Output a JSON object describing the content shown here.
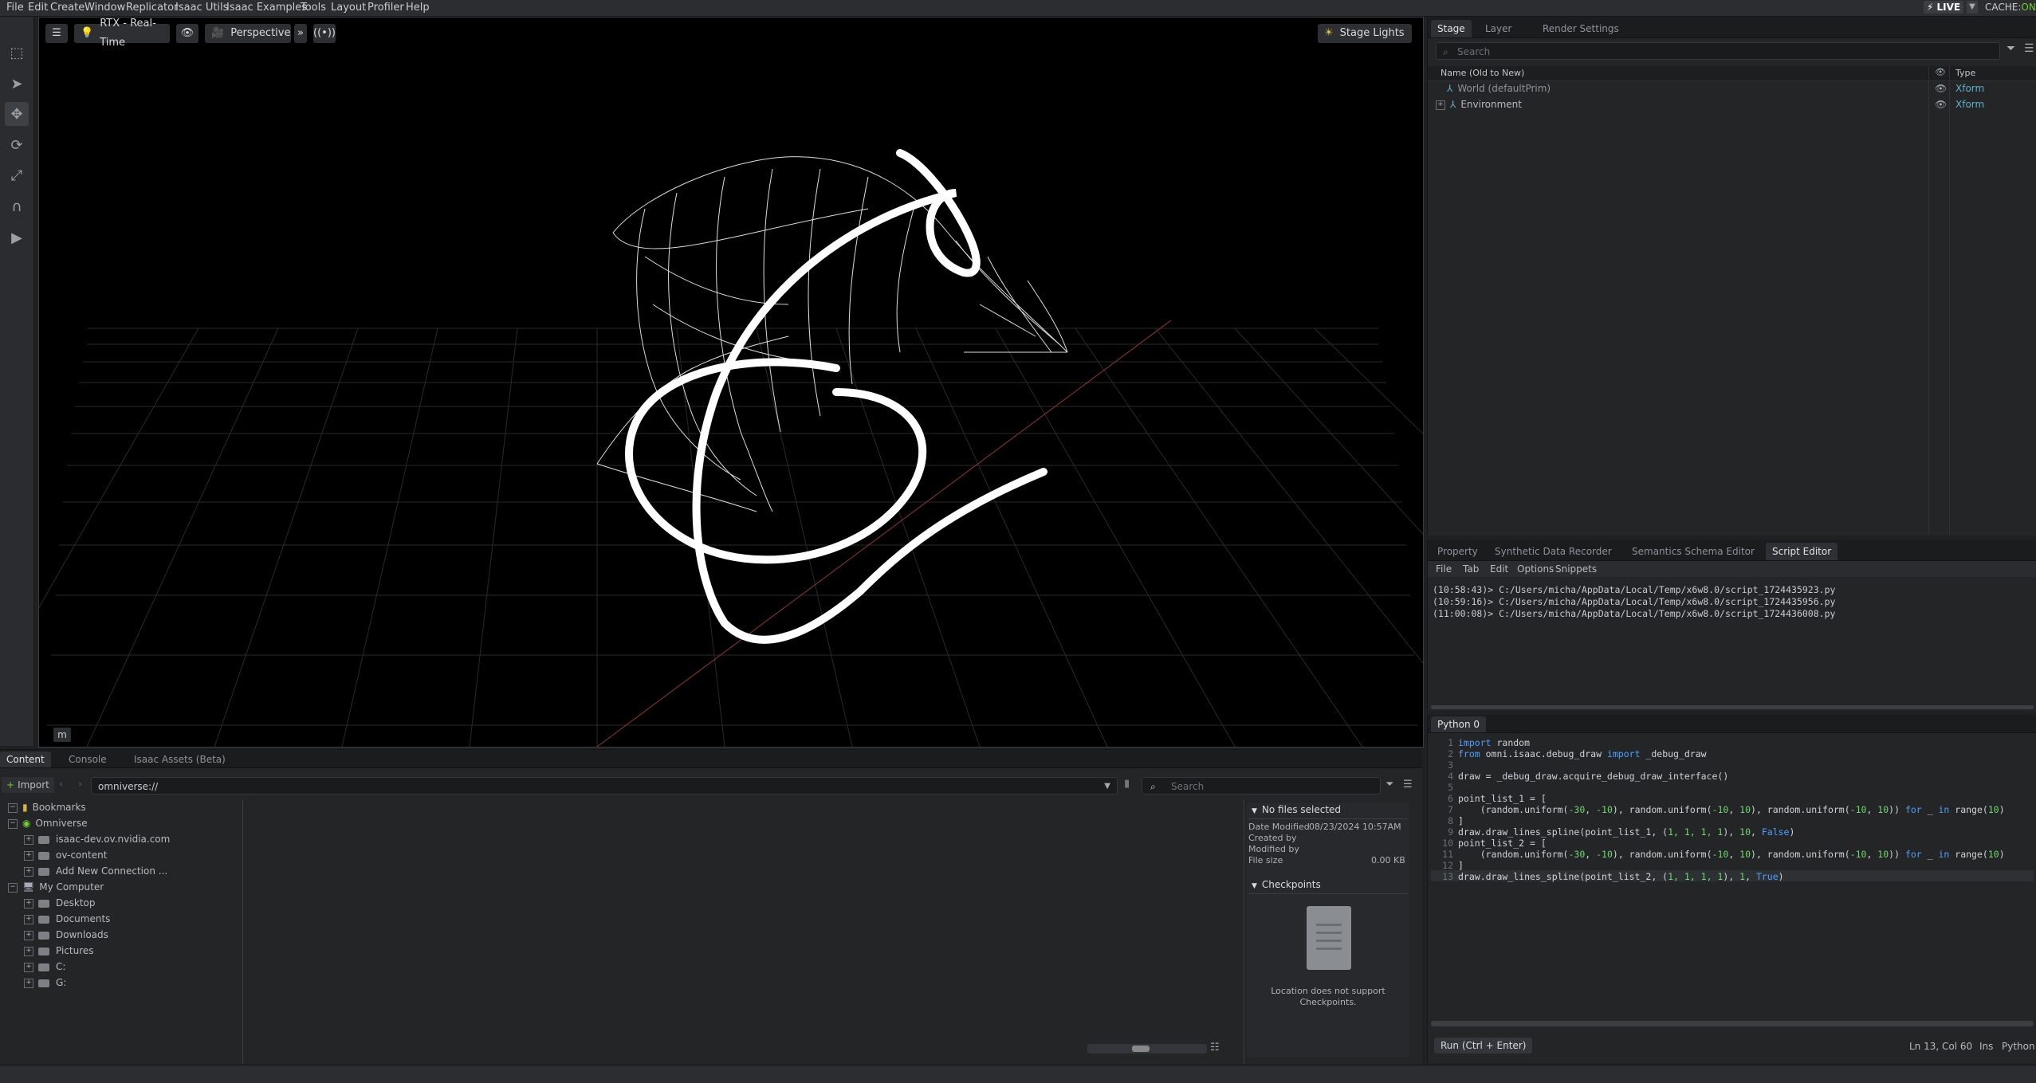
{
  "menu": [
    "File",
    "Edit",
    "Create",
    "Window",
    "Replicator",
    "Isaac Utils",
    "Isaac Examples",
    "Tools",
    "Layout",
    "Profiler",
    "Help"
  ],
  "status_top": {
    "live": "LIVE",
    "cache_label": "CACHE:",
    "cache_state": "ON"
  },
  "viewport": {
    "render_mode": "RTX - Real-Time",
    "camera": "Perspective",
    "stage_lights": "Stage Lights",
    "corner_label": "m"
  },
  "stage_panel": {
    "tabs": [
      "Stage",
      "Layer",
      "Render Settings"
    ],
    "search_placeholder": "Search",
    "col_name": "Name (Old to New)",
    "col_type": "Type",
    "rows": [
      {
        "name": "World (defaultPrim)",
        "type": "Xform"
      },
      {
        "name": "Environment",
        "type": "Xform"
      }
    ]
  },
  "property_panel": {
    "tabs": [
      "Property",
      "Synthetic Data Recorder",
      "Semantics Schema Editor",
      "Script Editor"
    ],
    "menu": [
      "File",
      "Tab",
      "Edit",
      "Options",
      "Snippets"
    ],
    "log": [
      "(10:58:43)> C:/Users/micha/AppData/Local/Temp/x6w8.0/script_1724435923.py",
      "(10:59:16)> C:/Users/micha/AppData/Local/Temp/x6w8.0/script_1724435956.py",
      "(11:00:08)> C:/Users/micha/AppData/Local/Temp/x6w8.0/script_1724436008.py"
    ]
  },
  "python_panel": {
    "tab": "Python 0",
    "line_numbers": [
      "1",
      "2",
      "3",
      "4",
      "5",
      "6",
      "7",
      "8",
      "9",
      "10",
      "11",
      "12",
      "13"
    ],
    "run_label": "Run (Ctrl + Enter)",
    "cursor": "Ln 13, Col 60",
    "ins": "Ins",
    "lang": "Python"
  },
  "content_panel": {
    "tabs": [
      "Content",
      "Console",
      "Isaac Assets (Beta)"
    ],
    "import": "Import",
    "path": "omniverse://",
    "search_placeholder": "Search",
    "tree": {
      "bookmarks": "Bookmarks",
      "omniverse": "Omniverse",
      "omni_children": [
        "isaac-dev.ov.nvidia.com",
        "ov-content",
        "Add New Connection ..."
      ],
      "mycomputer": "My Computer",
      "computer_children": [
        "Desktop",
        "Documents",
        "Downloads",
        "Pictures",
        "C:",
        "G:"
      ]
    },
    "details": {
      "header": "No files selected",
      "date_label": "Date Modified",
      "date_value": "08/23/2024 10:57AM",
      "created_by": "Created by",
      "modified_by": "Modified by",
      "file_size": "File size",
      "file_size_value": "0.00 KB",
      "checkpoints": "Checkpoints",
      "checkpoint_msg_1": "Location does not support",
      "checkpoint_msg_2": "Checkpoints."
    }
  },
  "code": {
    "l1_kw": "import",
    "l1_rest": " random",
    "l2_kw": "from",
    "l2_mod": " omni.isaac.debug_draw ",
    "l2_kw2": "import",
    "l2_rest": " _debug_draw",
    "l4": "draw = _debug_draw.acquire_debug_draw_interface()",
    "l6": "point_list_1 = [",
    "l7_a": "    (random.uniform(",
    "l7_n1": "-30",
    "l7_c1": ", ",
    "l7_n2": "-10",
    "l7_b": "), random.uniform(",
    "l7_n3": "-10",
    "l7_c2": ", ",
    "l7_n4": "10",
    "l7_c": "), random.uniform(",
    "l7_n5": "-10",
    "l7_c3": ", ",
    "l7_n6": "10",
    "l7_d": ")) ",
    "l7_for": "for",
    "l7_e": " _ ",
    "l7_in": "in",
    "l7_f": " range(",
    "l7_n7": "10",
    "l7_g": ")",
    "l8": "]",
    "l9_a": "draw.draw_lines_spline(point_list_1, (",
    "l9_n": "1, 1, 1, 1",
    "l9_b": "), ",
    "l9_n2": "10",
    "l9_c": ", ",
    "l9_kw": "False",
    "l9_d": ")",
    "l10": "point_list_2 = [",
    "l11_a": "    (random.uniform(",
    "l11_n1": "-30",
    "l11_c1": ", ",
    "l11_n2": "-10",
    "l11_b": "), random.uniform(",
    "l11_n3": "-10",
    "l11_c2": ", ",
    "l11_n4": "10",
    "l11_c": "), random.uniform(",
    "l11_n5": "-10",
    "l11_c3": ", ",
    "l11_n6": "10",
    "l11_d": ")) ",
    "l11_for": "for",
    "l11_e": " _ ",
    "l11_in": "in",
    "l11_f": " range(",
    "l11_n7": "10",
    "l11_g": ")",
    "l12": "]",
    "l13_a": "draw.draw_lines_spline(point_list_2, (",
    "l13_n": "1, 1, 1, 1",
    "l13_b": "), ",
    "l13_n2": "1",
    "l13_c": ", ",
    "l13_kw": "True",
    "l13_d": ")"
  }
}
